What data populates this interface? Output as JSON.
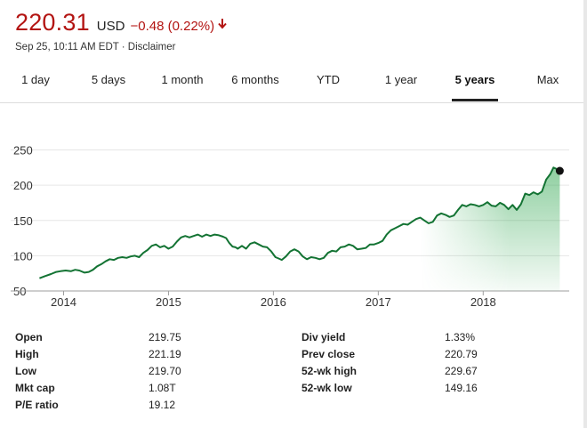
{
  "quote": {
    "price": "220.31",
    "currency": "USD",
    "change": "−0.48 (0.22%)",
    "direction_icon": "arrow-down-icon",
    "timestamp": "Sep 25, 10:11 AM EDT",
    "separator": " · ",
    "disclaimer": "Disclaimer",
    "down_color": "#b31412"
  },
  "tabs": [
    {
      "label": "1 day",
      "active": false
    },
    {
      "label": "5 days",
      "active": false
    },
    {
      "label": "1 month",
      "active": false
    },
    {
      "label": "6 months",
      "active": false
    },
    {
      "label": "YTD",
      "active": false
    },
    {
      "label": "1 year",
      "active": false
    },
    {
      "label": "5 years",
      "active": true
    },
    {
      "label": "Max",
      "active": false
    }
  ],
  "chart_data": {
    "type": "area",
    "title": "",
    "xlabel": "",
    "ylabel": "",
    "line_color": "#137333",
    "fill_color": "#34a853",
    "grid": true,
    "ylim": [
      50,
      262
    ],
    "xlim": [
      2013.75,
      2018.82
    ],
    "y_ticks": [
      50,
      100,
      150,
      200,
      250
    ],
    "y_tick_labels": [
      "50",
      "100",
      "150",
      "200",
      "250"
    ],
    "x_ticks": [
      2014,
      2015,
      2016,
      2017,
      2018
    ],
    "x_tick_labels": [
      "2014",
      "2015",
      "2016",
      "2017",
      "2018"
    ],
    "points": [
      [
        2013.77,
        68
      ],
      [
        2013.82,
        71
      ],
      [
        2013.88,
        74
      ],
      [
        2013.93,
        77
      ],
      [
        2013.97,
        78
      ],
      [
        2014.02,
        79
      ],
      [
        2014.07,
        78
      ],
      [
        2014.11,
        80
      ],
      [
        2014.15,
        79
      ],
      [
        2014.2,
        76
      ],
      [
        2014.24,
        77
      ],
      [
        2014.28,
        80
      ],
      [
        2014.32,
        85
      ],
      [
        2014.36,
        88
      ],
      [
        2014.4,
        92
      ],
      [
        2014.44,
        95
      ],
      [
        2014.48,
        94
      ],
      [
        2014.52,
        97
      ],
      [
        2014.56,
        98
      ],
      [
        2014.6,
        97
      ],
      [
        2014.64,
        99
      ],
      [
        2014.68,
        100
      ],
      [
        2014.72,
        98
      ],
      [
        2014.76,
        104
      ],
      [
        2014.8,
        108
      ],
      [
        2014.84,
        114
      ],
      [
        2014.88,
        116
      ],
      [
        2014.92,
        112
      ],
      [
        2014.96,
        114
      ],
      [
        2015.0,
        110
      ],
      [
        2015.04,
        113
      ],
      [
        2015.08,
        120
      ],
      [
        2015.12,
        126
      ],
      [
        2015.16,
        128
      ],
      [
        2015.2,
        126
      ],
      [
        2015.24,
        128
      ],
      [
        2015.28,
        130
      ],
      [
        2015.32,
        127
      ],
      [
        2015.36,
        130
      ],
      [
        2015.4,
        128
      ],
      [
        2015.44,
        130
      ],
      [
        2015.48,
        129
      ],
      [
        2015.52,
        127
      ],
      [
        2015.55,
        125
      ],
      [
        2015.58,
        118
      ],
      [
        2015.61,
        113
      ],
      [
        2015.64,
        112
      ],
      [
        2015.66,
        110
      ],
      [
        2015.7,
        114
      ],
      [
        2015.74,
        110
      ],
      [
        2015.78,
        117
      ],
      [
        2015.82,
        119
      ],
      [
        2015.86,
        116
      ],
      [
        2015.9,
        113
      ],
      [
        2015.94,
        112
      ],
      [
        2015.98,
        106
      ],
      [
        2016.02,
        98
      ],
      [
        2016.05,
        96
      ],
      [
        2016.08,
        94
      ],
      [
        2016.12,
        99
      ],
      [
        2016.16,
        106
      ],
      [
        2016.2,
        109
      ],
      [
        2016.24,
        106
      ],
      [
        2016.28,
        99
      ],
      [
        2016.32,
        95
      ],
      [
        2016.36,
        98
      ],
      [
        2016.4,
        97
      ],
      [
        2016.44,
        95
      ],
      [
        2016.48,
        97
      ],
      [
        2016.52,
        104
      ],
      [
        2016.56,
        107
      ],
      [
        2016.6,
        106
      ],
      [
        2016.64,
        112
      ],
      [
        2016.68,
        113
      ],
      [
        2016.72,
        116
      ],
      [
        2016.76,
        114
      ],
      [
        2016.8,
        109
      ],
      [
        2016.84,
        110
      ],
      [
        2016.88,
        111
      ],
      [
        2016.92,
        116
      ],
      [
        2016.96,
        116
      ],
      [
        2017.0,
        118
      ],
      [
        2017.04,
        121
      ],
      [
        2017.08,
        130
      ],
      [
        2017.12,
        136
      ],
      [
        2017.16,
        139
      ],
      [
        2017.2,
        142
      ],
      [
        2017.24,
        145
      ],
      [
        2017.28,
        144
      ],
      [
        2017.32,
        148
      ],
      [
        2017.36,
        152
      ],
      [
        2017.4,
        154
      ],
      [
        2017.44,
        150
      ],
      [
        2017.48,
        146
      ],
      [
        2017.52,
        148
      ],
      [
        2017.56,
        157
      ],
      [
        2017.6,
        160
      ],
      [
        2017.64,
        158
      ],
      [
        2017.68,
        155
      ],
      [
        2017.72,
        157
      ],
      [
        2017.76,
        165
      ],
      [
        2017.8,
        172
      ],
      [
        2017.84,
        170
      ],
      [
        2017.88,
        173
      ],
      [
        2017.92,
        172
      ],
      [
        2017.96,
        170
      ],
      [
        2018.0,
        172
      ],
      [
        2018.04,
        176
      ],
      [
        2018.08,
        171
      ],
      [
        2018.12,
        170
      ],
      [
        2018.16,
        175
      ],
      [
        2018.2,
        172
      ],
      [
        2018.24,
        166
      ],
      [
        2018.28,
        172
      ],
      [
        2018.32,
        165
      ],
      [
        2018.36,
        173
      ],
      [
        2018.4,
        188
      ],
      [
        2018.44,
        186
      ],
      [
        2018.48,
        190
      ],
      [
        2018.52,
        187
      ],
      [
        2018.56,
        191
      ],
      [
        2018.6,
        208
      ],
      [
        2018.64,
        216
      ],
      [
        2018.67,
        225
      ],
      [
        2018.7,
        223
      ],
      [
        2018.73,
        220.31
      ]
    ],
    "last_point": [
      2018.73,
      220.31
    ]
  },
  "stats": {
    "left": [
      {
        "label": "Open",
        "value": "219.75"
      },
      {
        "label": "High",
        "value": "221.19"
      },
      {
        "label": "Low",
        "value": "219.70"
      },
      {
        "label": "Mkt cap",
        "value": "1.08T"
      },
      {
        "label": "P/E ratio",
        "value": "19.12"
      }
    ],
    "right": [
      {
        "label": "Div yield",
        "value": "1.33%"
      },
      {
        "label": "Prev close",
        "value": "220.79"
      },
      {
        "label": "52-wk high",
        "value": "229.67"
      },
      {
        "label": "52-wk low",
        "value": "149.16"
      }
    ]
  }
}
